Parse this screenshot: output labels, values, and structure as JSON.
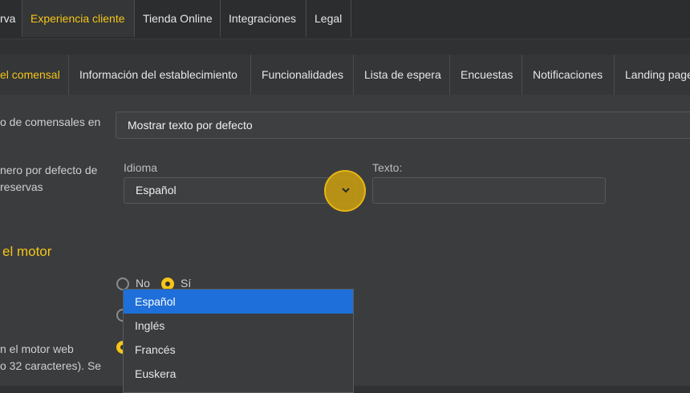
{
  "topnav": {
    "tabs": [
      {
        "label": "rva"
      },
      {
        "label": "Experiencia cliente"
      },
      {
        "label": "Tienda Online"
      },
      {
        "label": "Integraciones"
      },
      {
        "label": "Legal"
      }
    ]
  },
  "subnav": {
    "tabs": [
      {
        "label": "el comensal"
      },
      {
        "label": "Información del establecimiento"
      },
      {
        "label": "Funcionalidades"
      },
      {
        "label": "Lista de espera"
      },
      {
        "label": "Encuestas"
      },
      {
        "label": "Notificaciones"
      },
      {
        "label": "Landing page"
      }
    ]
  },
  "form": {
    "row1_label": "o de comensales en",
    "row1_value": "Mostrar texto por defecto",
    "row2_label_line1": "nero por defecto de",
    "row2_label_line2": "reservas",
    "idioma_label": "Idioma",
    "idioma_value": "Español",
    "texto_label": "Texto:",
    "texto_value": ""
  },
  "section": {
    "title": "el motor"
  },
  "radio_group": {
    "no_label": "No",
    "si_label": "Sí"
  },
  "bottom_label": {
    "line1": "n el motor web",
    "line2": "o 32 caracteres). Se"
  },
  "dropdown": {
    "options": [
      {
        "label": "Español"
      },
      {
        "label": "Inglés"
      },
      {
        "label": "Francés"
      },
      {
        "label": "Euskera"
      }
    ]
  }
}
